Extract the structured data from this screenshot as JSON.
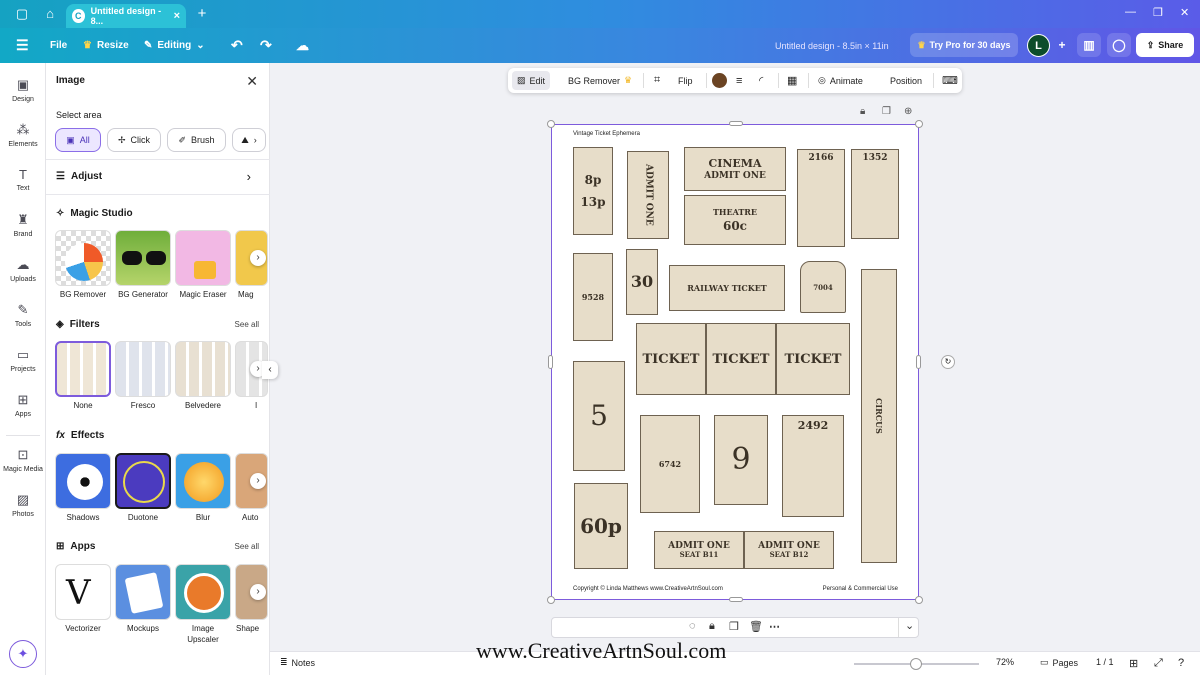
{
  "browser": {
    "tab_title": "Untitled design - 8...",
    "tab_logo": "C"
  },
  "topbar": {
    "file": "File",
    "resize": "Resize",
    "editing": "Editing",
    "doc_title": "Untitled design - 8.5in × 11in",
    "try_pro": "Try Pro for 30 days",
    "avatar_letter": "L",
    "share": "Share"
  },
  "rail": [
    {
      "label": "Design",
      "icon": "design-icon"
    },
    {
      "label": "Elements",
      "icon": "elements-icon"
    },
    {
      "label": "Text",
      "icon": "text-icon"
    },
    {
      "label": "Brand",
      "icon": "brand-icon"
    },
    {
      "label": "Uploads",
      "icon": "uploads-icon"
    },
    {
      "label": "Tools",
      "icon": "tools-icon"
    },
    {
      "label": "Projects",
      "icon": "projects-icon"
    },
    {
      "label": "Apps",
      "icon": "apps-icon"
    },
    {
      "label": "Magic Media",
      "icon": "magic-media-icon"
    },
    {
      "label": "Photos",
      "icon": "photos-icon"
    }
  ],
  "panel": {
    "title": "Image",
    "select_area": "Select area",
    "select_buttons": [
      "All",
      "Click",
      "Brush"
    ],
    "adjust": "Adjust",
    "magic_studio": "Magic Studio",
    "magic_items": [
      "BG Remover",
      "BG Generator",
      "Magic Eraser",
      "Mag"
    ],
    "filters": "Filters",
    "filters_see_all": "See all",
    "filter_items": [
      "None",
      "Fresco",
      "Belvedere",
      "I"
    ],
    "effects": "Effects",
    "effect_items": [
      "Shadows",
      "Duotone",
      "Blur",
      "Auto"
    ],
    "apps": "Apps",
    "apps_see_all": "See all",
    "app_items": [
      "Vectorizer",
      "Mockups",
      "Image Upscaler",
      "Shape"
    ]
  },
  "toolbar": {
    "edit": "Edit",
    "bg_remover": "BG Remover",
    "flip": "Flip",
    "animate": "Animate",
    "position": "Position",
    "color": "#6b4423"
  },
  "page": {
    "heading": "Vintage Ticket Ephemera",
    "copyright": "Copyright © Linda Matthews www.CreativeArtnSoul.com",
    "usage": "Personal & Commercial Use",
    "tickets": {
      "t1": "8p",
      "t1b": "13p",
      "t2": "ADMIT ONE",
      "cinema": "CINEMA",
      "admit": "ADMIT ONE",
      "theatre": "THEATRE",
      "price": "60c",
      "num1": "2166",
      "num2": "1352",
      "railway": "RAILWAY TICKET",
      "n30": "30",
      "ticket": "TICKET",
      "circus": "CIRCUS",
      "n5": "5",
      "n9": "9",
      "n2492": "2492",
      "p60": "60p",
      "seat1": "SEAT B11",
      "seat2": "SEAT B12"
    }
  },
  "bottom": {
    "notes": "Notes",
    "zoom": "72%",
    "pages": "Pages",
    "page_count": "1 / 1"
  },
  "watermark": "www.CreativeArtnSoul.com"
}
